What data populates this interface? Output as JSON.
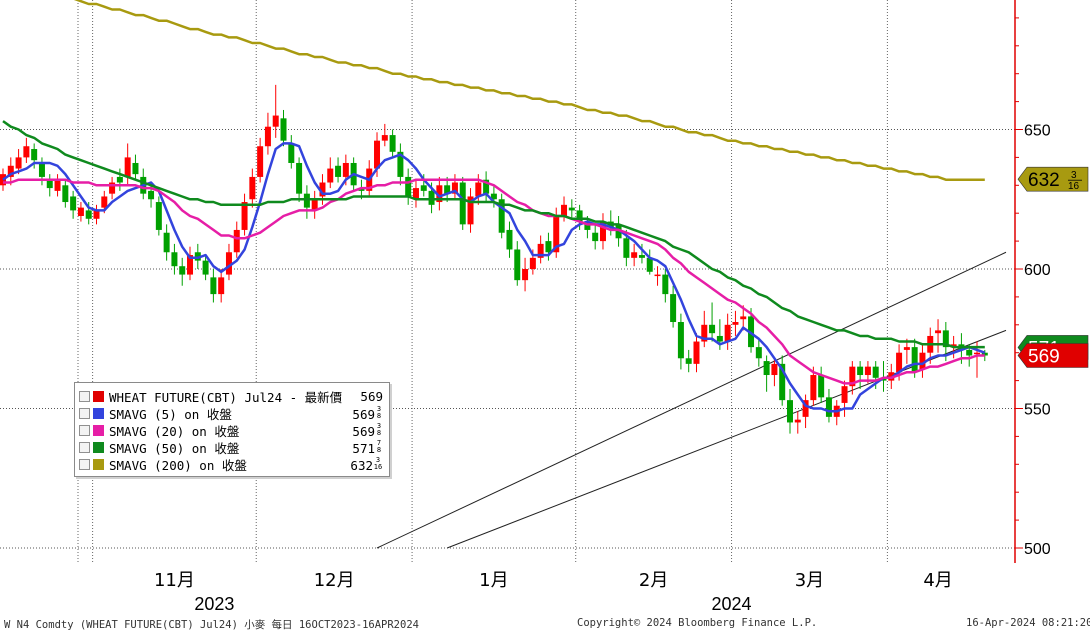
{
  "colors": {
    "price_up": "#ff0000",
    "price_down": "#00a000",
    "sma5": "#3344dd",
    "sma20": "#e61ea6",
    "sma50": "#0f8a1e",
    "sma200": "#a89a10",
    "axis_red": "#e00000",
    "grid": "#b8b8b8"
  },
  "chart_data": {
    "type": "candlestick",
    "title": "",
    "y_axis": {
      "min": 500,
      "max": 700,
      "ticks": [
        500,
        550,
        600,
        650
      ],
      "tick_labels": [
        "500",
        "550",
        "600",
        "650"
      ],
      "position": "right"
    },
    "x_axis": {
      "month_labels": [
        "11月",
        "12月",
        "1月",
        "2月",
        "3月",
        "4月"
      ],
      "year_labels": [
        "2023",
        "2024"
      ]
    },
    "dates": [
      "2023-10-16",
      "2023-10-17",
      "2023-10-18",
      "2023-10-19",
      "2023-10-20",
      "2023-10-23",
      "2023-10-24",
      "2023-10-25",
      "2023-10-26",
      "2023-10-27",
      "2023-10-30",
      "2023-10-31",
      "2023-11-01",
      "2023-11-02",
      "2023-11-03",
      "2023-11-06",
      "2023-11-07",
      "2023-11-08",
      "2023-11-09",
      "2023-11-10",
      "2023-11-13",
      "2023-11-14",
      "2023-11-15",
      "2023-11-16",
      "2023-11-17",
      "2023-11-20",
      "2023-11-21",
      "2023-11-22",
      "2023-11-24",
      "2023-11-27",
      "2023-11-28",
      "2023-11-29",
      "2023-11-30",
      "2023-12-01",
      "2023-12-04",
      "2023-12-05",
      "2023-12-06",
      "2023-12-07",
      "2023-12-08",
      "2023-12-11",
      "2023-12-12",
      "2023-12-13",
      "2023-12-14",
      "2023-12-15",
      "2023-12-18",
      "2023-12-19",
      "2023-12-20",
      "2023-12-21",
      "2023-12-22",
      "2023-12-26",
      "2023-12-27",
      "2023-12-28",
      "2023-12-29",
      "2024-01-02",
      "2024-01-03",
      "2024-01-04",
      "2024-01-05",
      "2024-01-08",
      "2024-01-09",
      "2024-01-10",
      "2024-01-11",
      "2024-01-12",
      "2024-01-16",
      "2024-01-17",
      "2024-01-18",
      "2024-01-19",
      "2024-01-22",
      "2024-01-23",
      "2024-01-24",
      "2024-01-25",
      "2024-01-26",
      "2024-01-29",
      "2024-01-30",
      "2024-01-31",
      "2024-02-01",
      "2024-02-02",
      "2024-02-05",
      "2024-02-06",
      "2024-02-07",
      "2024-02-08",
      "2024-02-09",
      "2024-02-12",
      "2024-02-13",
      "2024-02-14",
      "2024-02-15",
      "2024-02-16",
      "2024-02-20",
      "2024-02-21",
      "2024-02-22",
      "2024-02-23",
      "2024-02-26",
      "2024-02-27",
      "2024-02-28",
      "2024-02-29",
      "2024-03-01",
      "2024-03-04",
      "2024-03-05",
      "2024-03-06",
      "2024-03-07",
      "2024-03-08",
      "2024-03-11",
      "2024-03-12",
      "2024-03-13",
      "2024-03-14",
      "2024-03-15",
      "2024-03-18",
      "2024-03-19",
      "2024-03-20",
      "2024-03-21",
      "2024-03-22",
      "2024-03-25",
      "2024-03-26",
      "2024-03-27",
      "2024-03-28",
      "2024-04-01",
      "2024-04-02",
      "2024-04-03",
      "2024-04-04",
      "2024-04-05",
      "2024-04-08",
      "2024-04-09",
      "2024-04-10",
      "2024-04-11",
      "2024-04-12",
      "2024-04-15",
      "2024-04-16"
    ],
    "close": [
      634,
      637,
      640,
      644,
      639,
      633,
      629,
      632,
      624,
      621,
      622,
      618,
      621,
      626,
      631,
      631,
      640,
      634,
      627,
      625,
      614,
      606,
      601,
      598,
      605,
      603,
      598,
      591,
      597,
      606,
      614,
      624,
      633,
      644,
      651,
      655,
      646,
      638,
      627,
      622,
      625,
      631,
      636,
      633,
      638,
      630,
      628,
      636,
      646,
      648,
      642,
      633,
      626,
      629,
      628,
      623,
      630,
      627,
      631,
      616,
      626,
      631,
      627,
      625,
      613,
      607,
      596,
      600,
      604,
      609,
      606,
      619,
      623,
      621,
      617,
      614,
      610,
      617,
      615,
      611,
      604,
      606,
      604,
      599,
      598,
      591,
      581,
      568,
      566,
      574,
      580,
      577,
      574,
      580,
      581,
      583,
      572,
      568,
      562,
      566,
      553,
      545,
      546,
      553,
      562,
      554,
      547,
      551,
      558,
      565,
      562,
      565,
      561,
      560,
      563,
      570,
      572,
      563,
      570,
      576,
      578,
      572,
      573,
      571,
      569,
      570,
      569
    ],
    "open": [
      630,
      633,
      636,
      640,
      643,
      638,
      632,
      628,
      630,
      626,
      619,
      621,
      618,
      622,
      627,
      633,
      633,
      638,
      633,
      628,
      624,
      613,
      606,
      601,
      598,
      606,
      603,
      597,
      591,
      598,
      606,
      614,
      625,
      633,
      644,
      651,
      654,
      645,
      638,
      627,
      621,
      626,
      631,
      637,
      633,
      638,
      629,
      628,
      636,
      646,
      648,
      642,
      633,
      625,
      630,
      628,
      624,
      630,
      627,
      631,
      616,
      626,
      632,
      627,
      625,
      614,
      607,
      596,
      600,
      604,
      610,
      606,
      619,
      622,
      621,
      617,
      613,
      610,
      617,
      616,
      611,
      604,
      605,
      604,
      598,
      598,
      591,
      581,
      568,
      566,
      574,
      580,
      576,
      574,
      580,
      582,
      583,
      572,
      567,
      562,
      566,
      553,
      545,
      547,
      553,
      562,
      554,
      547,
      552,
      558,
      565,
      562,
      565,
      561,
      560,
      563,
      571,
      572,
      564,
      570,
      577,
      578,
      572,
      573,
      571,
      570,
      570
    ],
    "high": [
      636,
      640,
      643,
      647,
      645,
      640,
      634,
      634,
      632,
      628,
      624,
      624,
      623,
      628,
      633,
      636,
      645,
      641,
      636,
      630,
      626,
      616,
      609,
      604,
      608,
      609,
      605,
      600,
      600,
      609,
      617,
      627,
      636,
      647,
      656,
      666,
      657,
      648,
      640,
      630,
      628,
      634,
      640,
      640,
      641,
      640,
      632,
      639,
      649,
      652,
      650,
      645,
      636,
      632,
      634,
      631,
      633,
      633,
      634,
      633,
      629,
      634,
      635,
      630,
      627,
      617,
      610,
      604,
      607,
      612,
      613,
      622,
      626,
      625,
      623,
      619,
      616,
      620,
      621,
      619,
      614,
      609,
      609,
      607,
      601,
      600,
      594,
      584,
      571,
      577,
      585,
      588,
      582,
      584,
      585,
      587,
      586,
      575,
      569,
      568,
      569,
      557,
      549,
      555,
      565,
      565,
      557,
      553,
      560,
      567,
      567,
      567,
      567,
      567,
      566,
      573,
      575,
      575,
      573,
      579,
      582,
      581,
      576,
      577,
      573,
      574,
      571
    ],
    "low": [
      628,
      630,
      634,
      638,
      636,
      630,
      626,
      626,
      622,
      618,
      617,
      616,
      616,
      620,
      625,
      628,
      630,
      632,
      625,
      622,
      612,
      603,
      598,
      594,
      596,
      600,
      596,
      588,
      588,
      596,
      604,
      612,
      622,
      631,
      641,
      647,
      644,
      636,
      624,
      618,
      618,
      623,
      629,
      631,
      630,
      628,
      625,
      626,
      633,
      644,
      640,
      630,
      623,
      622,
      626,
      620,
      621,
      624,
      625,
      614,
      613,
      623,
      624,
      622,
      611,
      604,
      594,
      592,
      598,
      602,
      603,
      604,
      617,
      618,
      614,
      611,
      607,
      607,
      612,
      608,
      601,
      601,
      602,
      598,
      594,
      588,
      579,
      564,
      563,
      563,
      572,
      574,
      571,
      571,
      576,
      578,
      570,
      565,
      556,
      558,
      551,
      541,
      541,
      543,
      551,
      552,
      545,
      544,
      547,
      555,
      557,
      559,
      557,
      556,
      557,
      560,
      566,
      561,
      561,
      566,
      570,
      567,
      568,
      566,
      565,
      561,
      567
    ],
    "series": [
      {
        "name": "SMAVG (5)",
        "color": "#3344dd",
        "values": [
          632,
          634,
          635,
          636,
          638,
          638,
          638,
          637,
          634,
          630,
          626,
          622,
          621,
          621,
          624,
          626,
          628,
          629,
          630,
          631,
          628,
          621,
          614,
          608,
          604,
          604,
          605,
          601,
          599,
          601,
          603,
          607,
          615,
          624,
          634,
          643,
          645,
          645,
          644,
          637,
          631,
          627,
          627,
          628,
          632,
          634,
          633,
          632,
          636,
          639,
          640,
          641,
          639,
          636,
          632,
          629,
          626,
          627,
          628,
          625,
          624,
          626,
          627,
          624,
          622,
          620,
          614,
          610,
          605,
          605,
          605,
          608,
          609,
          614,
          616,
          617,
          616,
          616,
          615,
          614,
          612,
          610,
          607,
          604,
          603,
          601,
          595,
          589,
          582,
          576,
          575,
          575,
          573,
          574,
          575,
          579,
          577,
          575,
          572,
          568,
          564,
          559,
          555,
          551,
          550,
          550,
          549,
          549,
          550,
          550,
          555,
          557,
          559,
          561,
          561,
          563,
          565,
          566,
          566,
          568,
          569,
          569,
          570,
          571,
          572,
          571,
          570
        ]
      },
      {
        "name": "SMAVG (20)",
        "color": "#e61ea6",
        "values": [
          631,
          631,
          632,
          632,
          632,
          632,
          632,
          632,
          632,
          631,
          631,
          631,
          630,
          630,
          630,
          630,
          630,
          630,
          629,
          629,
          628,
          626,
          624,
          621,
          619,
          618,
          616,
          614,
          612,
          612,
          611,
          611,
          612,
          613,
          615,
          617,
          619,
          620,
          621,
          621,
          621,
          622,
          624,
          625,
          627,
          628,
          629,
          629,
          630,
          630,
          631,
          631,
          631,
          632,
          632,
          632,
          632,
          632,
          632,
          632,
          632,
          632,
          631,
          630,
          628,
          626,
          624,
          623,
          621,
          620,
          619,
          619,
          619,
          618,
          617,
          616,
          616,
          615,
          614,
          614,
          613,
          612,
          611,
          610,
          609,
          607,
          604,
          602,
          599,
          597,
          595,
          593,
          591,
          589,
          588,
          586,
          584,
          581,
          579,
          576,
          573,
          569,
          567,
          565,
          563,
          562,
          561,
          560,
          559,
          559,
          560,
          560,
          560,
          561,
          561,
          562,
          563,
          563,
          564,
          565,
          565,
          566,
          567,
          568,
          568,
          569,
          569
        ]
      },
      {
        "name": "SMAVG (50)",
        "color": "#0f8a1e",
        "values": [
          653,
          651,
          650,
          648,
          647,
          645,
          644,
          643,
          641,
          640,
          639,
          638,
          637,
          636,
          635,
          634,
          633,
          632,
          631,
          630,
          629,
          628,
          627,
          626,
          625,
          625,
          624,
          624,
          623,
          623,
          623,
          623,
          623,
          623,
          624,
          624,
          624,
          625,
          625,
          625,
          625,
          625,
          625,
          625,
          625,
          626,
          626,
          626,
          626,
          626,
          626,
          626,
          626,
          625,
          625,
          625,
          625,
          625,
          625,
          625,
          624,
          624,
          624,
          624,
          623,
          623,
          622,
          621,
          621,
          620,
          620,
          619,
          619,
          618,
          618,
          618,
          617,
          617,
          616,
          616,
          615,
          614,
          613,
          612,
          611,
          610,
          608,
          607,
          606,
          604,
          602,
          600,
          599,
          597,
          596,
          594,
          593,
          591,
          590,
          588,
          586,
          585,
          583,
          582,
          581,
          580,
          579,
          578,
          578,
          577,
          576,
          576,
          575,
          575,
          575,
          574,
          574,
          574,
          573,
          573,
          573,
          573,
          572,
          572,
          572,
          572,
          572
        ]
      },
      {
        "name": "SMAVG (200)",
        "color": "#a89a10",
        "values": [
          702,
          701,
          701,
          700,
          700,
          699,
          698,
          698,
          697,
          697,
          696,
          695,
          695,
          694,
          693,
          693,
          692,
          691,
          691,
          690,
          689,
          689,
          688,
          687,
          686,
          686,
          685,
          684,
          684,
          683,
          683,
          682,
          681,
          681,
          680,
          679,
          679,
          678,
          677,
          677,
          676,
          676,
          675,
          674,
          674,
          673,
          673,
          672,
          672,
          671,
          670,
          670,
          669,
          669,
          668,
          668,
          667,
          667,
          666,
          666,
          665,
          665,
          664,
          664,
          663,
          663,
          662,
          662,
          661,
          661,
          660,
          660,
          659,
          659,
          658,
          657,
          657,
          656,
          656,
          655,
          655,
          654,
          653,
          653,
          652,
          651,
          651,
          650,
          649,
          649,
          648,
          648,
          647,
          646,
          646,
          645,
          645,
          644,
          644,
          643,
          643,
          642,
          642,
          641,
          641,
          640,
          640,
          639,
          639,
          638,
          638,
          637,
          637,
          636,
          636,
          635,
          635,
          634,
          634,
          633,
          633,
          632,
          632,
          632,
          632,
          632,
          632
        ]
      }
    ],
    "trendlines": [
      {
        "points": [
          [
            "2023-12-22",
            500
          ],
          [
            "2024-04-16",
            606
          ]
        ]
      },
      {
        "points": [
          [
            "2024-01-08",
            500
          ],
          [
            "2024-04-16",
            578
          ]
        ]
      }
    ],
    "price_tags": [
      {
        "label": "632",
        "frac_num": "3",
        "frac_den": "16",
        "value": 632.1875,
        "color": "#a89a10"
      },
      {
        "label": "571",
        "value": 571.875,
        "color": "#0f8a1e"
      },
      {
        "label": "569",
        "value": 569,
        "color": "#e00000"
      }
    ]
  },
  "legend": {
    "rows": [
      {
        "label": "WHEAT FUTURE(CBT) Jul24 - 最新價",
        "value": "569",
        "frac_num": "",
        "frac_den": "",
        "color": "#e00000"
      },
      {
        "label": "SMAVG (5)  on 收盤",
        "value": "569",
        "frac_num": "3",
        "frac_den": "8",
        "color": "#3344dd"
      },
      {
        "label": "SMAVG (20)  on 收盤",
        "value": "569",
        "frac_num": "3",
        "frac_den": "8",
        "color": "#e61ea6"
      },
      {
        "label": "SMAVG (50)  on 收盤",
        "value": "571",
        "frac_num": "7",
        "frac_den": "8",
        "color": "#0f8a1e"
      },
      {
        "label": "SMAVG (200)  on 收盤",
        "value": "632",
        "frac_num": "3",
        "frac_den": "16",
        "color": "#a89a10"
      }
    ]
  },
  "footer": {
    "left": "W N4 Comdty (WHEAT FUTURE(CBT) Jul24) 小麥  每日 16OCT2023-16APR2024",
    "center": "Copyright© 2024 Bloomberg Finance L.P.",
    "right": "16-Apr-2024 08:21:20"
  }
}
